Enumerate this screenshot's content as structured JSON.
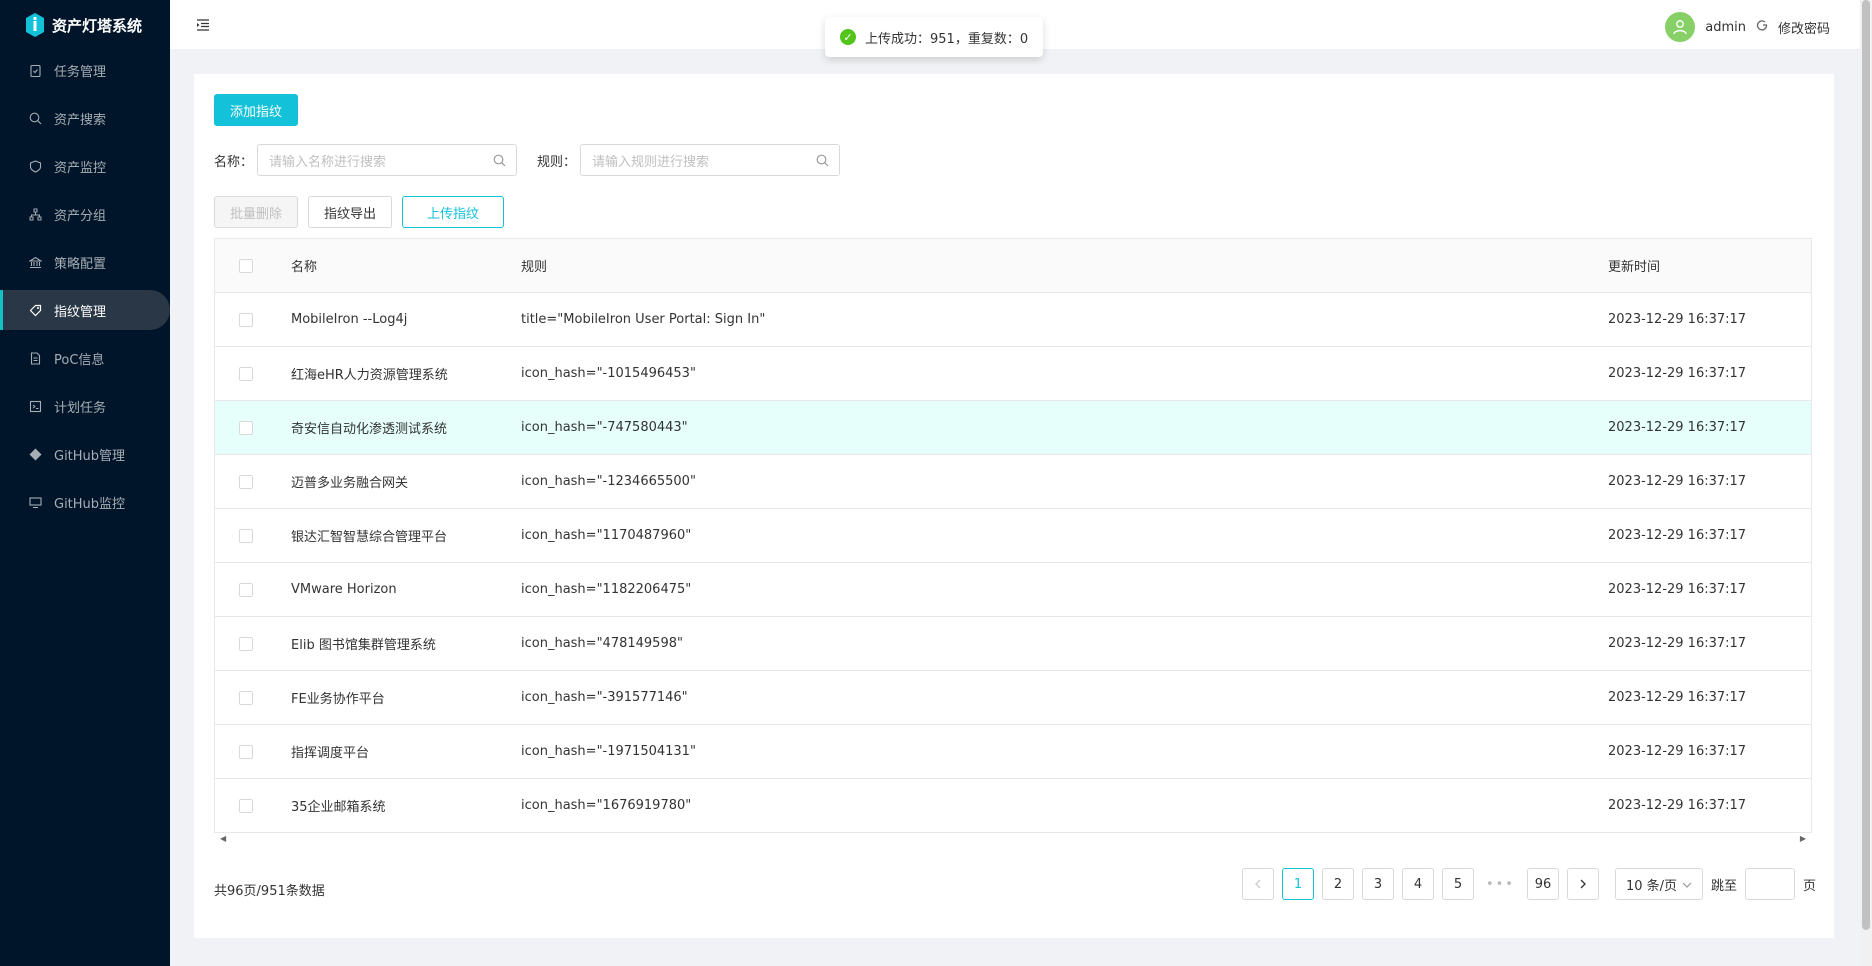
{
  "app": {
    "title": "资产灯塔系统"
  },
  "sidebar": {
    "items": [
      {
        "label": "任务管理",
        "icon": "clipboard-icon"
      },
      {
        "label": "资产搜索",
        "icon": "search-icon"
      },
      {
        "label": "资产监控",
        "icon": "shield-icon"
      },
      {
        "label": "资产分组",
        "icon": "cluster-icon"
      },
      {
        "label": "策略配置",
        "icon": "bank-icon"
      },
      {
        "label": "指纹管理",
        "icon": "tag-icon",
        "active": true
      },
      {
        "label": "PoC信息",
        "icon": "file-icon"
      },
      {
        "label": "计划任务",
        "icon": "schedule-icon"
      },
      {
        "label": "GitHub管理",
        "icon": "git-icon"
      },
      {
        "label": "GitHub监控",
        "icon": "monitor-icon"
      }
    ]
  },
  "header": {
    "username": "admin",
    "change_password": "修改密码"
  },
  "toast": {
    "message": "上传成功：951，重复数：0"
  },
  "toolbar": {
    "add_label": "添加指纹",
    "name_label": "名称：",
    "name_placeholder": "请输入名称进行搜索",
    "rule_label": "规则：",
    "rule_placeholder": "请输入规则进行搜索",
    "batch_delete": "批量删除",
    "export": "指纹导出",
    "upload": "上传指纹"
  },
  "table": {
    "columns": {
      "name": "名称",
      "rule": "规则",
      "time": "更新时间"
    },
    "rows": [
      {
        "name": "MobileIron --Log4j",
        "rule": "title=\"MobileIron User Portal: Sign In\"",
        "time": "2023-12-29 16:37:17"
      },
      {
        "name": "红海eHR人力资源管理系统",
        "rule": "icon_hash=\"-1015496453\"",
        "time": "2023-12-29 16:37:17"
      },
      {
        "name": "奇安信自动化渗透测试系统",
        "rule": "icon_hash=\"-747580443\"",
        "time": "2023-12-29 16:37:17"
      },
      {
        "name": "迈普多业务融合网关",
        "rule": "icon_hash=\"-1234665500\"",
        "time": "2023-12-29 16:37:17"
      },
      {
        "name": "银达汇智智慧综合管理平台",
        "rule": "icon_hash=\"1170487960\"",
        "time": "2023-12-29 16:37:17"
      },
      {
        "name": "VMware Horizon",
        "rule": "icon_hash=\"1182206475\"",
        "time": "2023-12-29 16:37:17"
      },
      {
        "name": "Elib 图书馆集群管理系统",
        "rule": "icon_hash=\"478149598\"",
        "time": "2023-12-29 16:37:17"
      },
      {
        "name": "FE业务协作平台",
        "rule": "icon_hash=\"-391577146\"",
        "time": "2023-12-29 16:37:17"
      },
      {
        "name": "指挥调度平台",
        "rule": "icon_hash=\"-1971504131\"",
        "time": "2023-12-29 16:37:17"
      },
      {
        "name": "35企业邮箱系统",
        "rule": "icon_hash=\"1676919780\"",
        "time": "2023-12-29 16:37:17"
      }
    ]
  },
  "pagination": {
    "summary": "共96页/951条数据",
    "pages": [
      "1",
      "2",
      "3",
      "4",
      "5"
    ],
    "ellipsis": "•••",
    "last": "96",
    "current": "1",
    "page_size": "10 条/页",
    "jump_label": "跳至",
    "page_suffix": "页"
  },
  "colors": {
    "accent": "#13c2d8",
    "sidebar_bg": "#001529",
    "success": "#52c41a",
    "hover_row": "#e6fffb"
  }
}
